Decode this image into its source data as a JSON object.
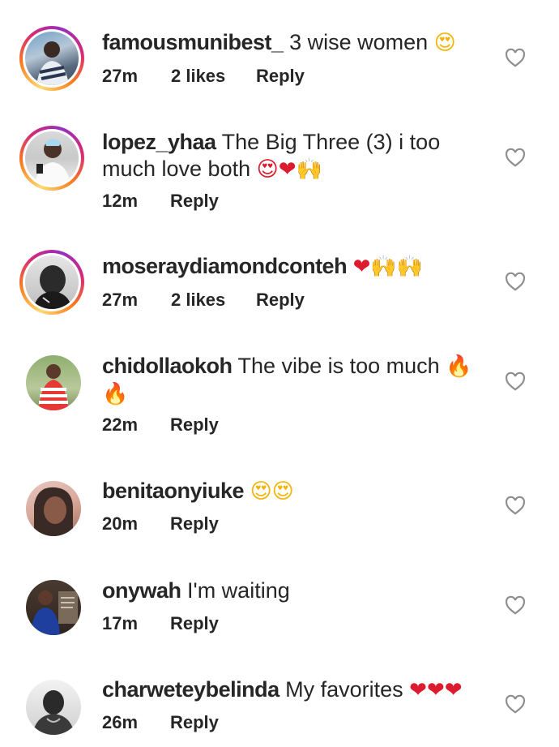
{
  "comments": [
    {
      "username": "famousmunibest_",
      "text": "3 wise women",
      "emoji": "😍",
      "time": "27m",
      "likes": "2 likes",
      "reply": "Reply"
    },
    {
      "username": "lopez_yhaa",
      "text": "The Big Three (3) i too much love both",
      "emoji": "😍❤🙌",
      "time": "12m",
      "reply": "Reply"
    },
    {
      "username": "moseraydiamondconteh",
      "text": "",
      "emoji": "❤🙌🙌",
      "time": "27m",
      "likes": "2 likes",
      "reply": "Reply"
    },
    {
      "username": "chidollaokoh",
      "text": "The vibe is too much",
      "emoji": "🔥🔥",
      "time": "22m",
      "reply": "Reply"
    },
    {
      "username": "benitaonyiuke",
      "text": "",
      "emoji": "😍😍",
      "time": "20m",
      "reply": "Reply"
    },
    {
      "username": "onywah",
      "text": "I'm waiting",
      "emoji": "",
      "time": "17m",
      "reply": "Reply"
    },
    {
      "username": "charweteybelinda",
      "text": "My favorites",
      "emoji": "❤❤❤",
      "time": "26m",
      "reply": "Reply"
    }
  ],
  "icons": {
    "like": "heart-outline-icon"
  },
  "colors": {
    "text": "#262626",
    "icon": "#8e8e8e",
    "heart_emoji": "#dd1b2e"
  }
}
